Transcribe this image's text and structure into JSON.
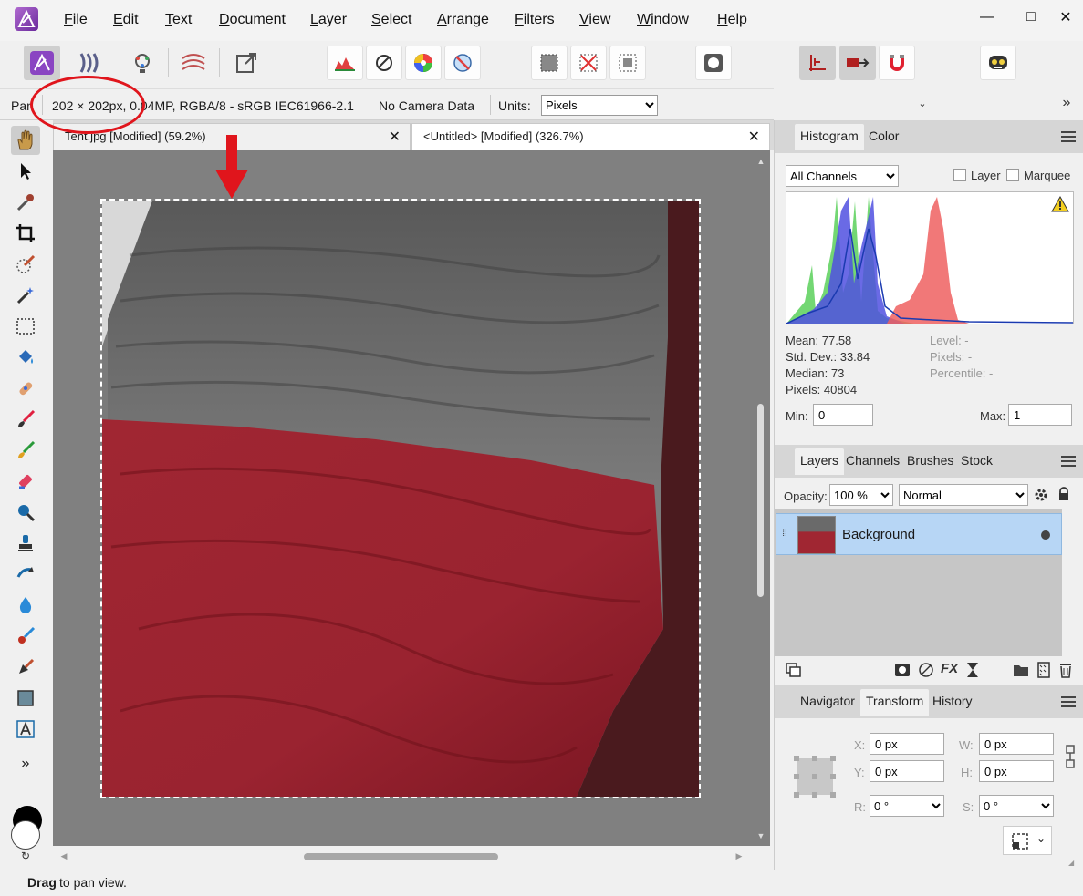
{
  "menu": {
    "items": [
      "File",
      "Edit",
      "Text",
      "Document",
      "Layer",
      "Select",
      "Arrange",
      "Filters",
      "View",
      "Window",
      "Help"
    ]
  },
  "window_controls": {
    "minimize": "—",
    "maximize": "□",
    "close": "✕"
  },
  "toolbar": {
    "personas": [
      "photo-persona-icon",
      "liquify-persona-icon",
      "develop-persona-icon",
      "tone-mapping-persona-icon",
      "export-persona-icon"
    ],
    "overflow": "»"
  },
  "context": {
    "tool_label": "Pan",
    "doc_info": "202 × 202px, 0.04MP, RGBA/8 - sRGB IEC61966-2.1",
    "camera": "No Camera Data",
    "units_label": "Units:",
    "units_value": "Pixels"
  },
  "tabs": [
    {
      "label": "Tent.jpg [Modified] (59.2%)",
      "close": "✕"
    },
    {
      "label": "<Untitled> [Modified] (326.7%)",
      "close": "✕"
    }
  ],
  "tools_more": "»",
  "status": {
    "bold": "Drag",
    "rest": " to pan view."
  },
  "histogram": {
    "tabs": [
      "Histogram",
      "Color"
    ],
    "channel_value": "All Channels",
    "layer_label": "Layer",
    "marquee_label": "Marquee",
    "mean": "Mean: 77.58",
    "std_dev": "Std. Dev.: 33.84",
    "median": "Median: 73",
    "pixels": "Pixels: 40804",
    "level": "Level: -",
    "pixels_right": "Pixels: -",
    "percentile": "Percentile: -",
    "min_label": "Min:",
    "min_value": "0",
    "max_label": "Max:",
    "max_value": "1"
  },
  "layers": {
    "tabs": [
      "Layers",
      "Channels",
      "Brushes",
      "Stock"
    ],
    "opacity_label": "Opacity:",
    "opacity_value": "100 %",
    "blend_value": "Normal",
    "layer_name": "Background"
  },
  "transform": {
    "tabs": [
      "Navigator",
      "Transform",
      "History"
    ],
    "x_label": "X:",
    "x_value": "0 px",
    "y_label": "Y:",
    "y_value": "0 px",
    "w_label": "W:",
    "w_value": "0 px",
    "h_label": "H:",
    "h_value": "0 px",
    "r_label": "R:",
    "r_value": "0 °",
    "s_label": "S:",
    "s_value": "0 °"
  },
  "colors": {
    "annotation": "#e0151c",
    "accent": "#7a3fb5",
    "selection": "#b7d6f5"
  }
}
